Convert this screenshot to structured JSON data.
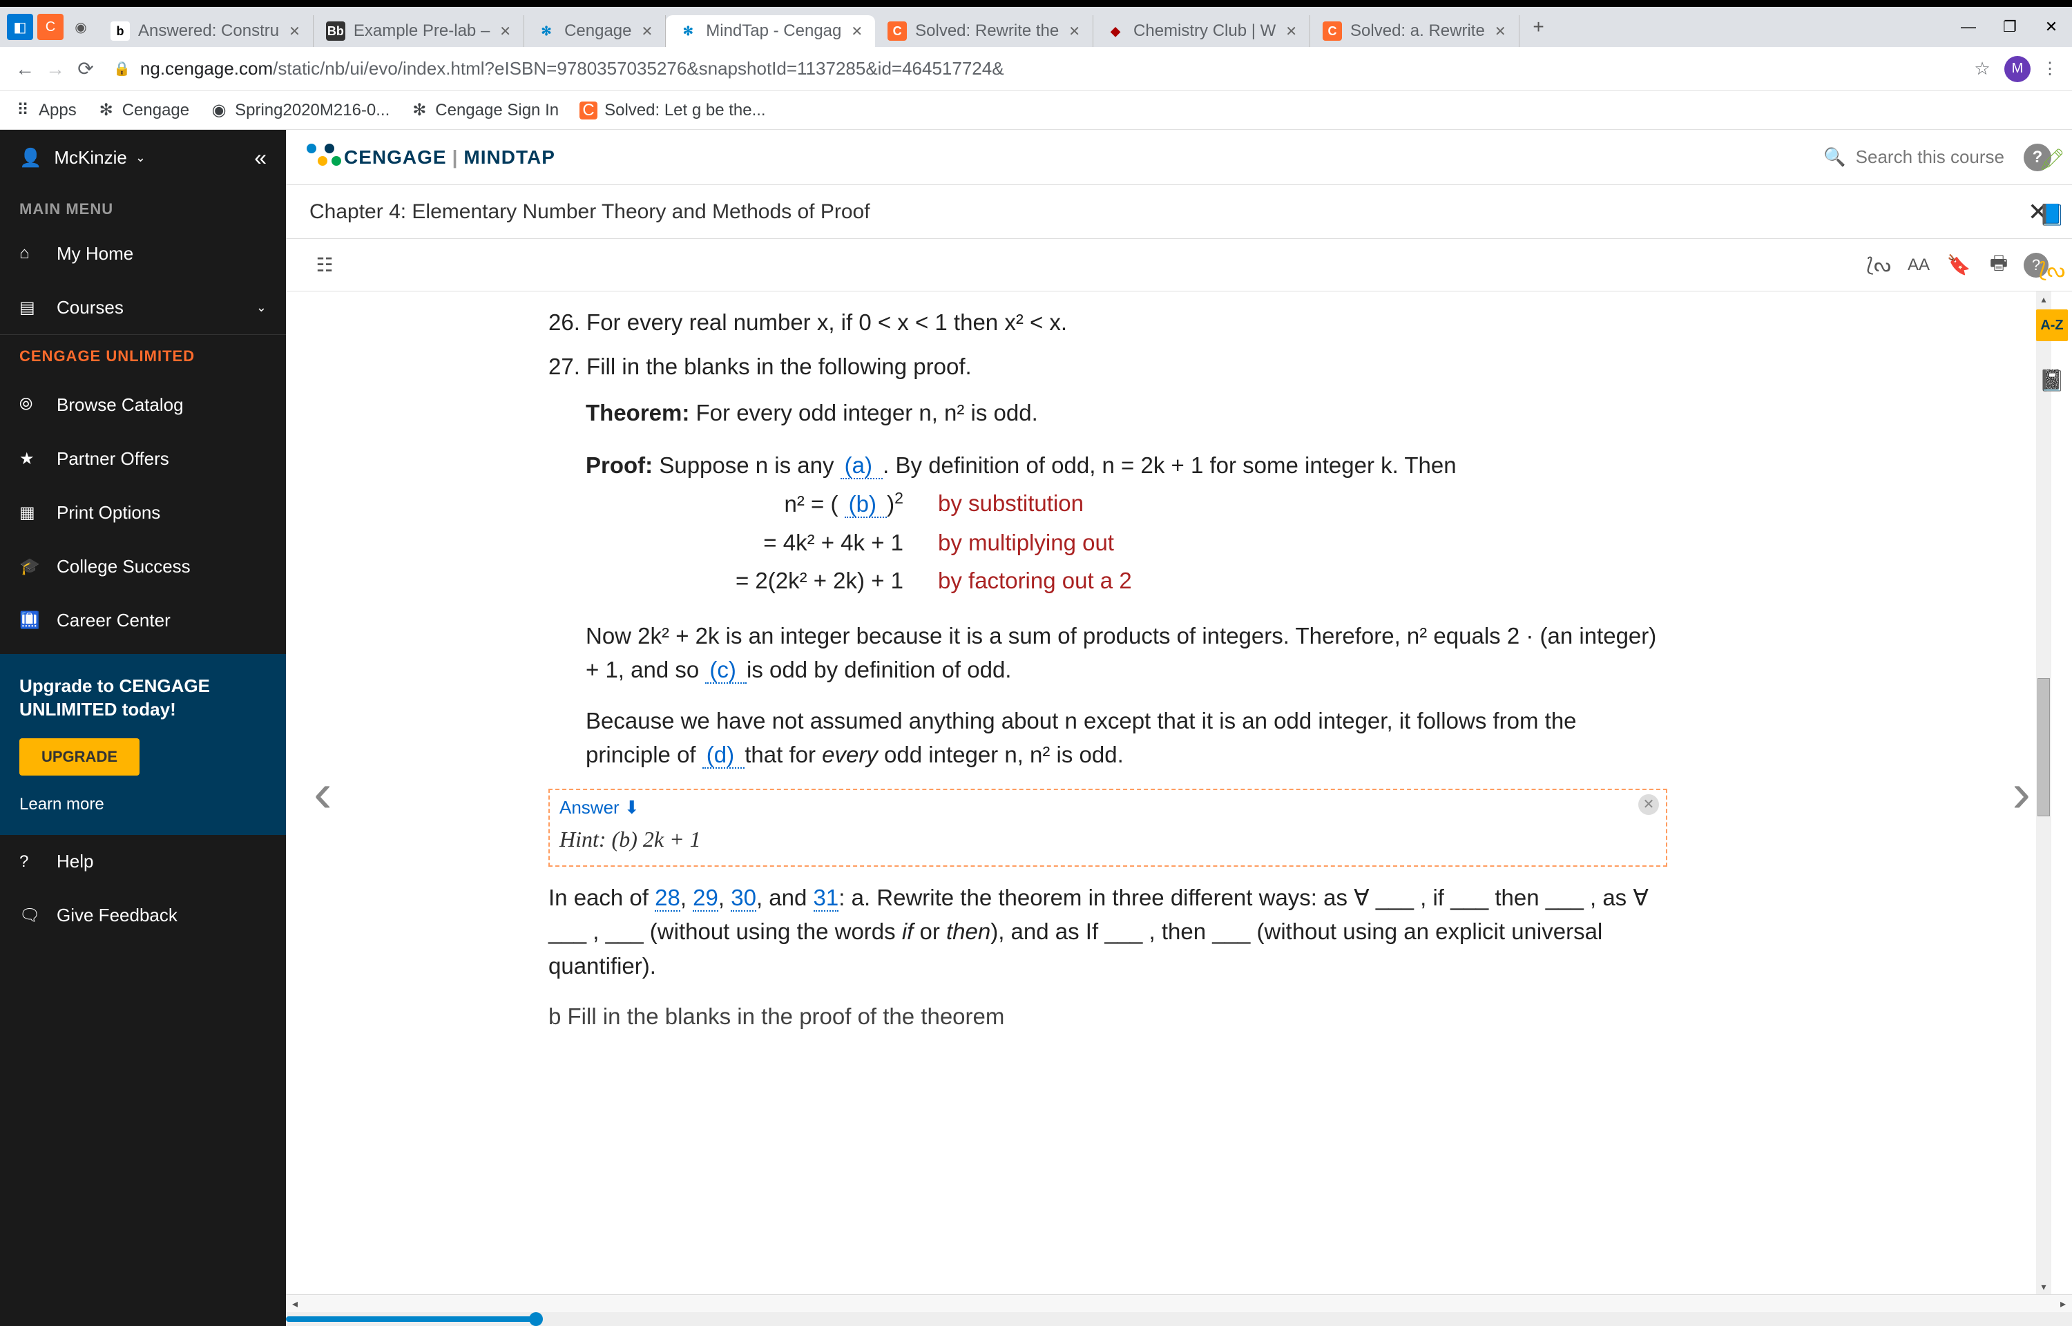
{
  "browser": {
    "tabs": [
      {
        "label": "Answered: Constru",
        "favicon": "b",
        "fav_bg": "#fff",
        "fav_color": "#000"
      },
      {
        "label": "Example Pre-lab –",
        "favicon": "Bb",
        "fav_bg": "#333",
        "fav_color": "#fff"
      },
      {
        "label": "Cengage",
        "favicon": "✻",
        "fav_bg": "transparent",
        "fav_color": "#0085ca"
      },
      {
        "label": "MindTap - Cengag",
        "favicon": "✻",
        "fav_bg": "transparent",
        "fav_color": "#0085ca",
        "active": true
      },
      {
        "label": "Solved: Rewrite the",
        "favicon": "C",
        "fav_bg": "#ff6b2c",
        "fav_color": "#fff"
      },
      {
        "label": "Chemistry Club | W",
        "favicon": "◆",
        "fav_bg": "transparent",
        "fav_color": "#a00"
      },
      {
        "label": "Solved: a. Rewrite",
        "favicon": "C",
        "fav_bg": "#ff6b2c",
        "fav_color": "#fff"
      }
    ],
    "url_secure": "ng.cengage.com",
    "url_rest": "/static/nb/ui/evo/index.html?eISBN=9780357035276&snapshotId=1137285&id=464517724&",
    "avatar": "M",
    "bookmarks": [
      {
        "label": "Apps",
        "icon": "⠿"
      },
      {
        "label": "Cengage",
        "icon": "✻"
      },
      {
        "label": "Spring2020M216-0...",
        "icon": "◉"
      },
      {
        "label": "Cengage Sign In",
        "icon": "✻"
      },
      {
        "label": "Solved: Let g be the...",
        "icon": "C",
        "icon_bg": "#ff6b2c",
        "icon_color": "#fff"
      }
    ]
  },
  "sidebar": {
    "user": "McKinzie",
    "main_menu": "MAIN MENU",
    "items": [
      {
        "label": "My Home",
        "icon": "⌂"
      },
      {
        "label": "Courses",
        "icon": "▤",
        "expand": true
      }
    ],
    "unlimited_head": "CENGAGE UNLIMITED",
    "unlimited_items": [
      {
        "label": "Browse Catalog",
        "icon": "⦾"
      },
      {
        "label": "Partner Offers",
        "icon": "★"
      },
      {
        "label": "Print Options",
        "icon": "▦"
      },
      {
        "label": "College Success",
        "icon": "🎓"
      },
      {
        "label": "Career Center",
        "icon": "🛄"
      }
    ],
    "upgrade_line1": "Upgrade to CENGAGE",
    "upgrade_line2": "UNLIMITED today!",
    "upgrade_btn": "UPGRADE",
    "learn_more": "Learn more",
    "help": "Help",
    "feedback": "Give Feedback"
  },
  "header": {
    "brand": "CENGAGE",
    "product": "MINDTAP",
    "search_placeholder": "Search this course",
    "chapter": "Chapter 4: Elementary Number Theory and Methods of Proof"
  },
  "content": {
    "p26": "26. For every real number x, if 0 < x < 1 then x² < x.",
    "p27": "27. Fill in the blanks in the following proof.",
    "theorem_label": "Theorem:",
    "theorem_body": " For every odd integer n, n² is odd.",
    "proof_label": "Proof:",
    "proof_1a": " Suppose n is any ",
    "blank_a": "  (a)  ",
    "proof_1b": " . By definition of odd, n = 2k + 1 for some integer k. Then",
    "eq1_l": "n² = ",
    "eq1_r_open": "( ",
    "blank_b": "  (b)  ",
    "eq1_r_close": " )",
    "eq1_sup": "2",
    "eq1_why": "by substitution",
    "eq2_l": "= 4k² + 4k + 1",
    "eq2_why": "by multiplying out",
    "eq3_l": "= 2(2k² + 2k) + 1",
    "eq3_why": "by factoring out a 2",
    "para2a": "Now 2k² + 2k is an integer because it is a sum of products of integers. Therefore, n² equals 2 · (an integer) + 1, and so ",
    "blank_c": "  (c)  ",
    "para2b": " is odd by definition of odd.",
    "para3a": "Because we have not assumed anything about n except that it is an odd integer, it follows from the principle of ",
    "blank_d": "  (d)  ",
    "para3b": " that for ",
    "para3_em": "every",
    "para3c": " odd integer n, n² is odd.",
    "answer_head": "Answer ⬇",
    "answer_hint": "Hint: (b) 2k + 1",
    "nextpara_a": "In each of ",
    "links": [
      "28",
      "29",
      "30",
      "31"
    ],
    "nextpara_b": ": a. Rewrite the theorem in three different ways: as ∀ ___ , if ___ then ___ , as ∀ ___ , ___ (without using the words ",
    "em_if": "if",
    "nextpara_c": " or ",
    "em_then": "then",
    "nextpara_d": "), and as If ___ , then ___ (without using an explicit universal quantifier).",
    "nextpara_e": "b  Fill in the blanks in the proof of the theorem"
  },
  "progress_pct": 14
}
